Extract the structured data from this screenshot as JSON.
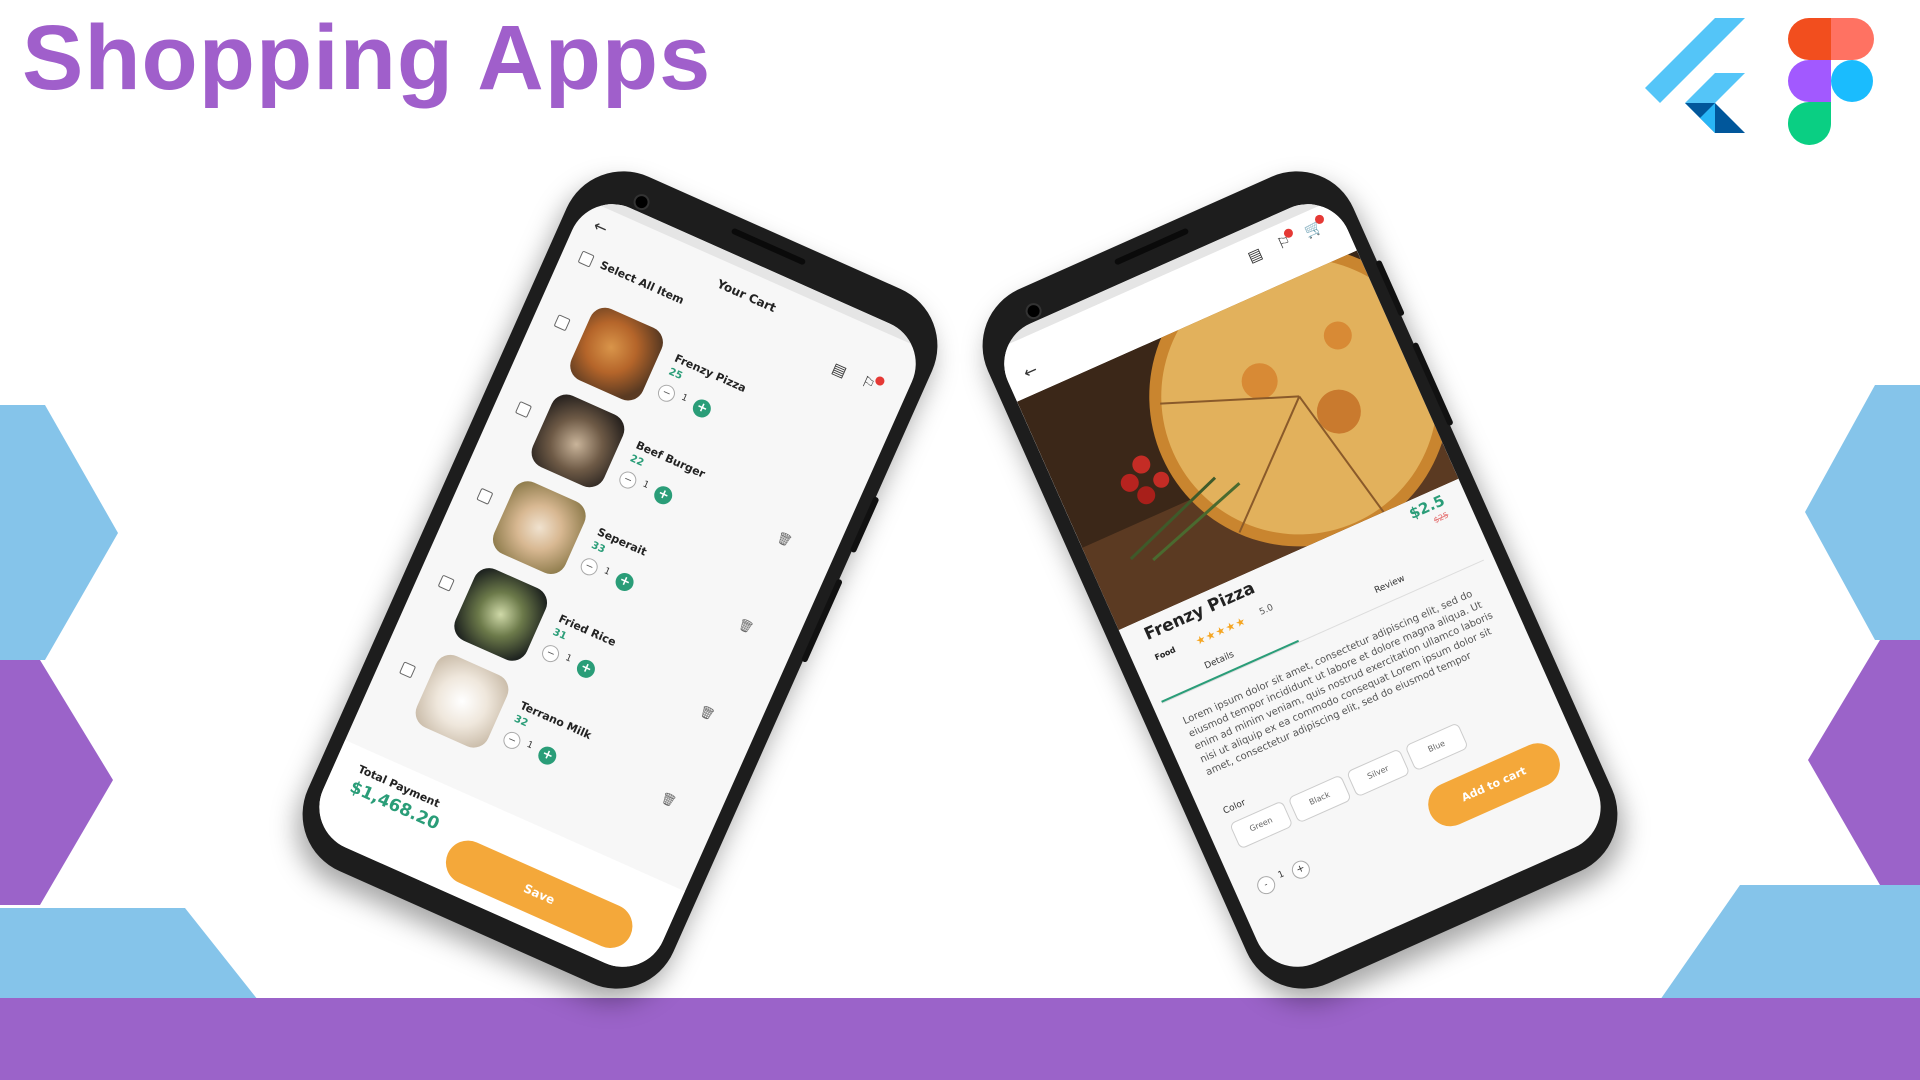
{
  "headline": "Shopping Apps",
  "logos": {
    "flutter": "flutter-logo",
    "figma": "figma-logo"
  },
  "colors": {
    "purple": "#9b63c9",
    "blue": "#85c4ea",
    "green": "#2a9d78",
    "orange": "#f4a83a"
  },
  "cart": {
    "title": "Your Cart",
    "select_all": "Select All Item",
    "items": [
      {
        "name": "Frenzy Pizza",
        "price": "25",
        "qty": "1"
      },
      {
        "name": "Beef Burger",
        "price": "22",
        "qty": "1"
      },
      {
        "name": "Seperait",
        "price": "33",
        "qty": "1"
      },
      {
        "name": "Fried Rice",
        "price": "31",
        "qty": "1"
      },
      {
        "name": "Terrano Milk",
        "price": "32",
        "qty": "1"
      }
    ],
    "total_label": "Total Payment",
    "total_amount": "$1,468.20",
    "save_label": "Save"
  },
  "product": {
    "name": "Frenzy Pizza",
    "price": "$2.5",
    "old_price": "$25",
    "category": "Food",
    "stars": "★★★★★",
    "rating": "5.0",
    "tab_details": "Details",
    "tab_review": "Review",
    "description": "Lorem ipsum dolor sit amet, consectetur adipiscing elit, sed do eiusmod tempor incididunt ut labore et dolore magna aliqua. Ut enim ad minim veniam, quis nostrud exercitation ullamco laboris nisi ut aliquip ex ea commodo consequat Lorem ipsum dolor sit amet, consectetur adipiscing elit, sed do eiusmod tempor",
    "color_label": "Color",
    "colors": [
      "Green",
      "Black",
      "Silver",
      "Blue"
    ],
    "qty": "1",
    "minus": "-",
    "plus": "+",
    "add_to_cart": "Add to cart"
  }
}
